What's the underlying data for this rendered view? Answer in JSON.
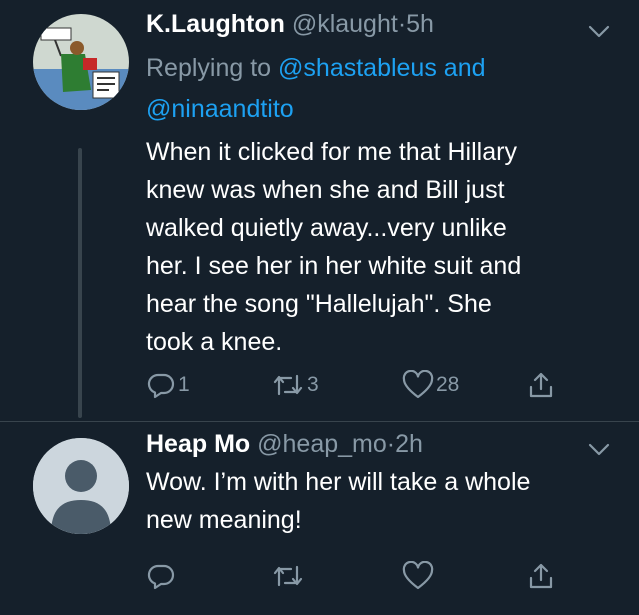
{
  "tweets": [
    {
      "name": "K.Laughton",
      "handle": "@klaught",
      "separator": "·",
      "time": "5h",
      "replying_prefix": "Replying to",
      "replying_mention1": "@shastableus",
      "replying_and": "and",
      "replying_mention2": "@ninaandtito",
      "body": [
        "When it clicked for me that Hillary",
        "knew was when she and Bill just",
        "walked quietly away...very unlike",
        "her. I see her in her white suit and",
        "hear the song \"Hallelujah\". She",
        "took a knee."
      ],
      "avatar_sign_text": "WE ARE THE NEW DEAL",
      "reply_count": "1",
      "retweet_count": "3",
      "like_count": "28",
      "icons": [
        "reply-icon",
        "retweet-icon",
        "like-icon",
        "share-icon",
        "chevron-down-icon"
      ]
    },
    {
      "name": "Heap Mo",
      "handle": "@heap_mo",
      "separator": "·",
      "time": "2h",
      "body": [
        "Wow.  I’m with her will take a whole",
        "new meaning!"
      ],
      "reply_count": "",
      "retweet_count": "",
      "like_count": "",
      "icons": [
        "reply-icon",
        "retweet-icon",
        "like-icon",
        "share-icon",
        "chevron-down-icon"
      ]
    }
  ],
  "colors": {
    "background": "#15202b",
    "secondary_text": "#8899a6",
    "link": "#1da1f2",
    "divider": "#38444d"
  }
}
